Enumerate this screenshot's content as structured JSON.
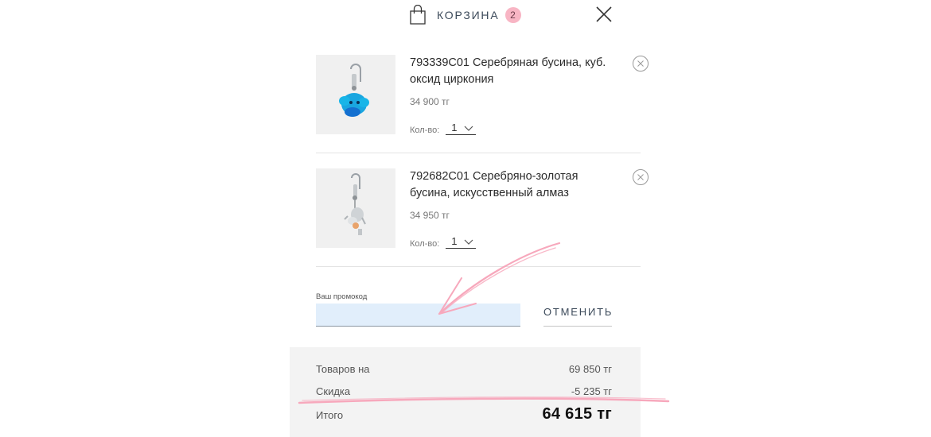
{
  "header": {
    "title": "КОРЗИНА",
    "count": "2"
  },
  "items": [
    {
      "name": "793339C01 Серебряная бусина, куб. оксид циркония",
      "price": "34 900 тг",
      "qty_label": "Кол-во:",
      "qty": "1"
    },
    {
      "name": "792682C01 Серебряно-золотая бусина, искусственный алмаз",
      "price": "34 950 тг",
      "qty_label": "Кол-во:",
      "qty": "1"
    }
  ],
  "promo": {
    "label": "Ваш промокод",
    "value": "",
    "cancel_label": "ОТМЕНИТЬ"
  },
  "summary": {
    "goods_label": "Товаров на",
    "goods_value": "69 850 тг",
    "discount_label": "Скидка",
    "discount_value": "-5 235 тг",
    "total_label": "Итого",
    "total_value": "64 615 тг"
  },
  "colors": {
    "badge": "#f8b5c4",
    "promo_bg": "#e1eefb",
    "annotation": "#f7a8bc",
    "summary_bg": "#f3f3f3"
  },
  "icons": [
    "shopping-bag-icon",
    "close-icon",
    "remove-item-icon",
    "chevron-down-icon"
  ]
}
